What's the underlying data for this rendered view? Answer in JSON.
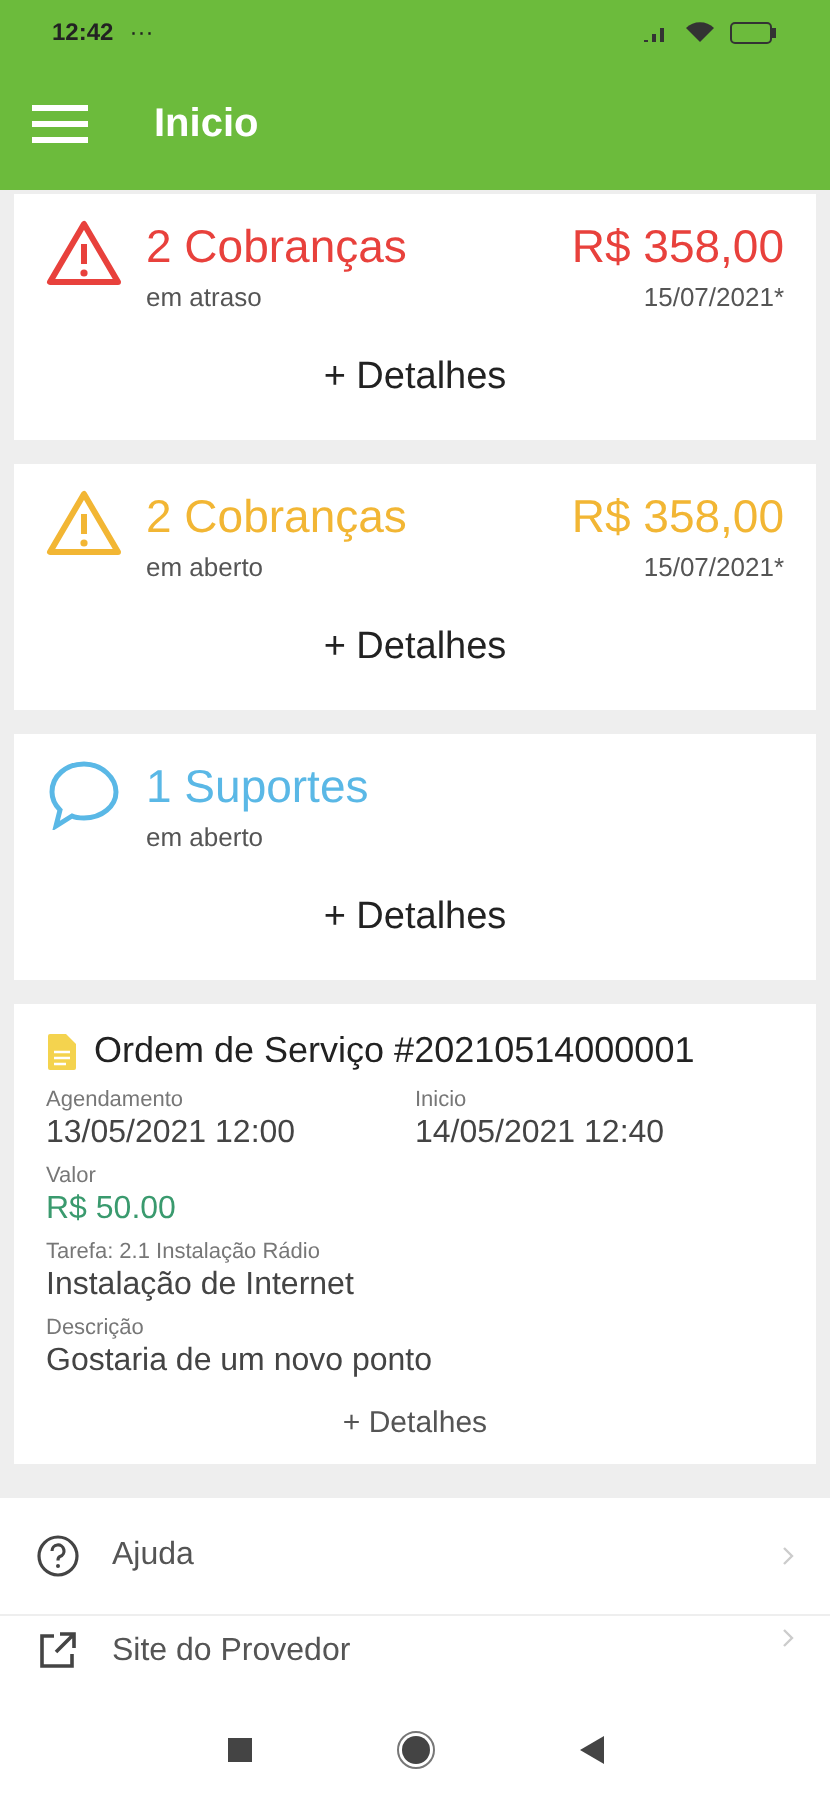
{
  "status_bar": {
    "time": "12:42",
    "more": "···"
  },
  "app_bar": {
    "title": "Inicio"
  },
  "summary_cards": [
    {
      "kind": "overdue",
      "title": "2 Cobranças",
      "subtitle": "em atraso",
      "amount": "R$ 358,00",
      "date": "15/07/2021*",
      "link": "+ Detalhes"
    },
    {
      "kind": "open",
      "title": "2 Cobranças",
      "subtitle": "em aberto",
      "amount": "R$ 358,00",
      "date": "15/07/2021*",
      "link": "+ Detalhes"
    },
    {
      "kind": "support",
      "title": "1 Suportes",
      "subtitle": "em aberto",
      "link": "+ Detalhes"
    }
  ],
  "service_order": {
    "title": "Ordem de Serviço #20210514000001",
    "schedule_label": "Agendamento",
    "schedule": "13/05/2021 12:00",
    "start_label": "Inicio",
    "start": "14/05/2021 12:40",
    "value_label": "Valor",
    "value": "R$ 50.00",
    "task_label": "Tarefa: 2.1 Instalação Rádio",
    "task": "Instalação de Internet",
    "description_label": "Descrição",
    "description": "Gostaria de um novo ponto",
    "link": "+ Detalhes"
  },
  "menu": [
    {
      "kind": "help",
      "label": "Ajuda"
    },
    {
      "kind": "external",
      "label": "Site do Provedor"
    }
  ]
}
